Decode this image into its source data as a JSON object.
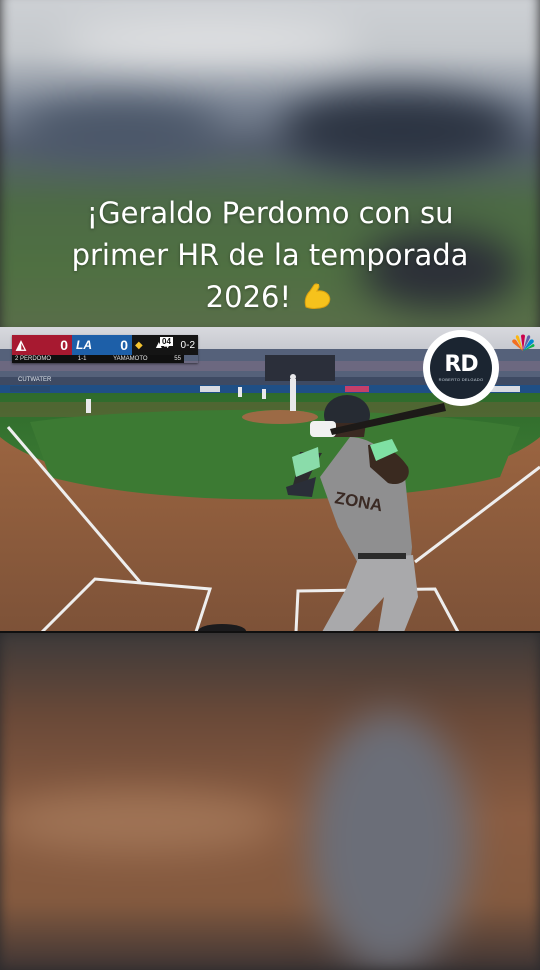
{
  "caption": {
    "line1": "¡Geraldo Perdomo con su",
    "line2": "primer HR de la temporada",
    "line3": "2026!",
    "emoji": "flexed-biceps"
  },
  "scorebug": {
    "away_score": "0",
    "home_score": "0",
    "home_logo": "LA",
    "inning": "▲4",
    "count": "0-2",
    "pitch_count": "04",
    "batter_label": "2 PERDOMO",
    "batter_stat": "1-1",
    "pitcher_label": "YAMAMOTO",
    "pitcher_stat": "55",
    "colors": {
      "away": "#a71930",
      "home": "#1d5fa8",
      "state": "#141414"
    }
  },
  "watermark": {
    "letters": "RD",
    "subtitle": "ROBERTO DELGADO"
  },
  "jersey_text": "ZONA",
  "field_signage": "CUTWATER",
  "icons": {
    "network": "nbc-peacock-icon",
    "logo": "rd-logo-icon"
  }
}
